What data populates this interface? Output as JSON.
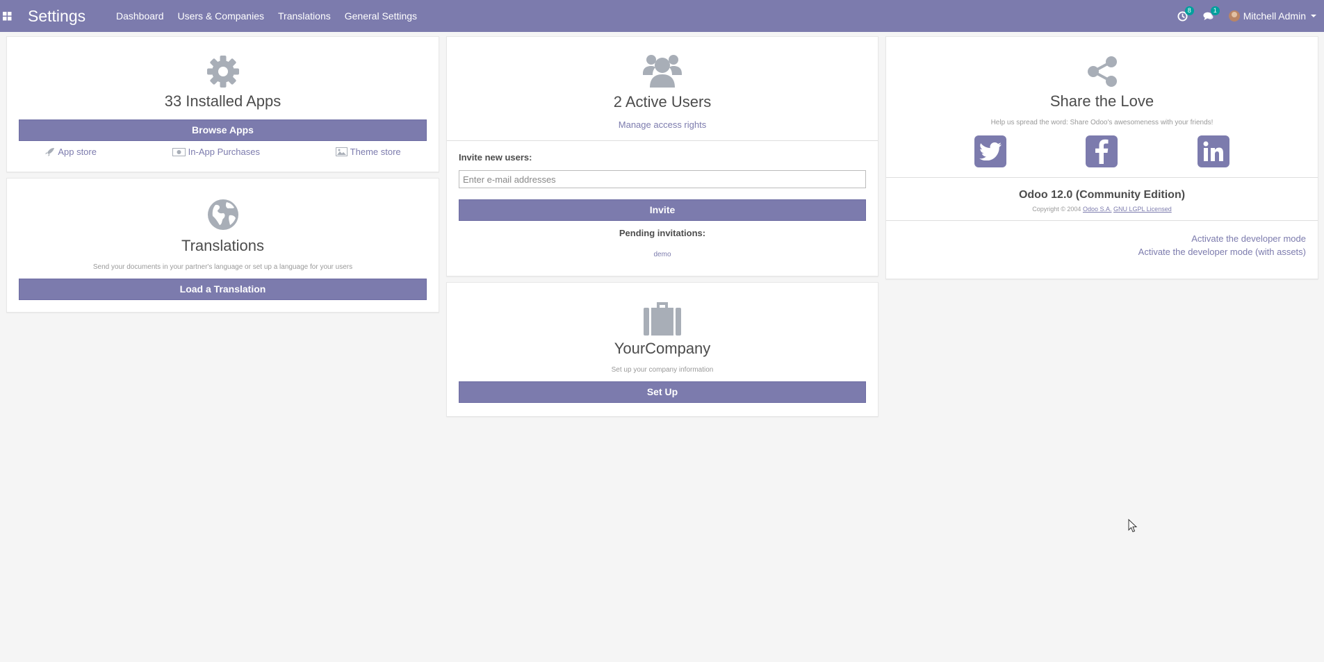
{
  "navbar": {
    "app_title": "Settings",
    "menu": [
      "Dashboard",
      "Users & Companies",
      "Translations",
      "General Settings"
    ],
    "activity_count": "8",
    "messages_count": "1",
    "user_name": "Mitchell Admin"
  },
  "apps_card": {
    "title": "33 Installed Apps",
    "button": "Browse Apps",
    "links": [
      "App store",
      "In-App Purchases",
      "Theme store"
    ]
  },
  "translations_card": {
    "title": "Translations",
    "subtitle": "Send your documents in your partner's language or set up a language for your users",
    "button": "Load a Translation"
  },
  "users_card": {
    "title": "2 Active Users",
    "manage_link": "Manage access rights",
    "invite_label": "Invite new users:",
    "invite_placeholder": "Enter e-mail addresses",
    "invite_button": "Invite",
    "pending_label": "Pending invitations:",
    "pending_users": [
      "demo"
    ]
  },
  "company_card": {
    "title": "YourCompany",
    "subtitle": "Set up your company information",
    "button": "Set Up"
  },
  "share_card": {
    "title": "Share the Love",
    "subtitle": "Help us spread the word: Share Odoo's awesomeness with your friends!",
    "social": [
      "twitter-icon",
      "facebook-icon",
      "linkedin-icon"
    ],
    "version": "Odoo 12.0 (Community Edition)",
    "copyright_prefix": "Copyright © 2004",
    "company_link": "Odoo S.A.",
    "license_link": "GNU LGPL Licensed",
    "dev_mode": "Activate the developer mode",
    "dev_mode_assets": "Activate the developer mode (with assets)"
  },
  "colors": {
    "brand": "#7c7bad",
    "badge": "#00a09d",
    "icon_grey": "#a8aeb7"
  }
}
